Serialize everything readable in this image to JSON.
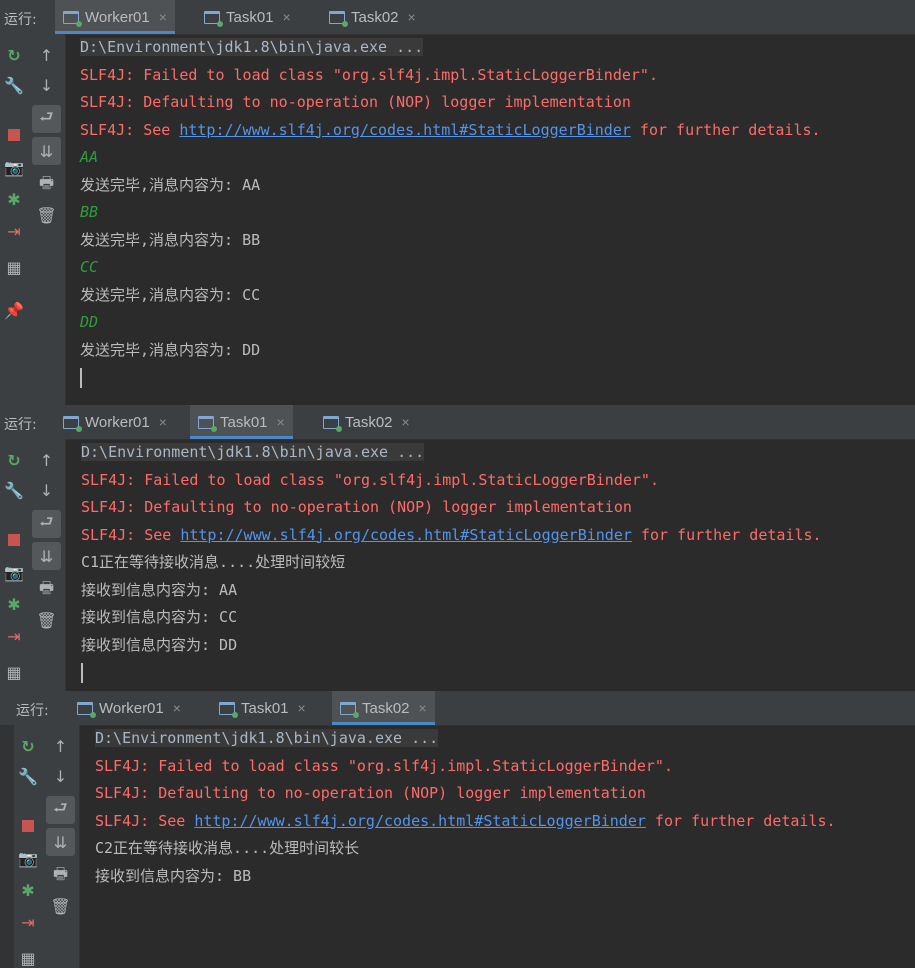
{
  "run_label": "运行:",
  "tabs": [
    "Worker01",
    "Task01",
    "Task02"
  ],
  "close_glyph": "×",
  "panels": [
    {
      "active_tab": 0,
      "lines": [
        {
          "type": "cmd",
          "text": "D:\\Environment\\jdk1.8\\bin\\java.exe ..."
        },
        {
          "type": "err",
          "text": "SLF4J: Failed to load class \"org.slf4j.impl.StaticLoggerBinder\"."
        },
        {
          "type": "err",
          "text": "SLF4J: Defaulting to no-operation (NOP) logger implementation"
        },
        {
          "type": "err",
          "text": "SLF4J: See ",
          "link": "http://www.slf4j.org/codes.html#StaticLoggerBinder",
          "after": " for further details."
        },
        {
          "type": "green",
          "text": "AA"
        },
        {
          "type": "msg",
          "text": "发送完毕,消息内容为: AA"
        },
        {
          "type": "green",
          "text": "BB"
        },
        {
          "type": "msg",
          "text": "发送完毕,消息内容为: BB"
        },
        {
          "type": "green",
          "text": "CC"
        },
        {
          "type": "msg",
          "text": "发送完毕,消息内容为: CC"
        },
        {
          "type": "green",
          "text": "DD"
        },
        {
          "type": "msg",
          "text": "发送完毕,消息内容为: DD"
        },
        {
          "type": "caret",
          "text": ""
        }
      ]
    },
    {
      "active_tab": 1,
      "lines": [
        {
          "type": "cmd",
          "text": "D:\\Environment\\jdk1.8\\bin\\java.exe ..."
        },
        {
          "type": "err",
          "text": "SLF4J: Failed to load class \"org.slf4j.impl.StaticLoggerBinder\"."
        },
        {
          "type": "err",
          "text": "SLF4J: Defaulting to no-operation (NOP) logger implementation"
        },
        {
          "type": "err",
          "text": "SLF4J: See ",
          "link": "http://www.slf4j.org/codes.html#StaticLoggerBinder",
          "after": " for further details."
        },
        {
          "type": "msg",
          "text": "C1正在等待接收消息....处理时间较短"
        },
        {
          "type": "msg",
          "text": "接收到信息内容为: AA"
        },
        {
          "type": "msg",
          "text": "接收到信息内容为: CC"
        },
        {
          "type": "msg",
          "text": "接收到信息内容为: DD"
        },
        {
          "type": "caret",
          "text": ""
        }
      ]
    },
    {
      "active_tab": 2,
      "lines": [
        {
          "type": "cmd",
          "text": "D:\\Environment\\jdk1.8\\bin\\java.exe ..."
        },
        {
          "type": "err",
          "text": "SLF4J: Failed to load class \"org.slf4j.impl.StaticLoggerBinder\"."
        },
        {
          "type": "err",
          "text": "SLF4J: Defaulting to no-operation (NOP) logger implementation"
        },
        {
          "type": "err",
          "text": "SLF4J: See ",
          "link": "http://www.slf4j.org/codes.html#StaticLoggerBinder",
          "after": " for further details."
        },
        {
          "type": "msg",
          "text": "C2正在等待接收消息....处理时间较长"
        },
        {
          "type": "msg",
          "text": "接收到信息内容为: BB"
        }
      ]
    }
  ],
  "icons": {
    "gutter1": [
      "rerun-icon",
      "wrench-icon",
      "stop-icon",
      "camera-icon",
      "debug-icon",
      "login-icon",
      "layout-icon",
      "pin-icon"
    ],
    "gutter2": [
      "arrow-up-icon",
      "arrow-down-icon",
      "soft-wrap-icon",
      "scroll-to-end-icon",
      "print-icon",
      "trash-icon"
    ]
  },
  "colors": {
    "background": "#2b2b2b",
    "error_text": "#ff6b68",
    "link": "#5394ec",
    "green_output": "#2e9e3a",
    "tab_accent": "#4a88c7"
  }
}
